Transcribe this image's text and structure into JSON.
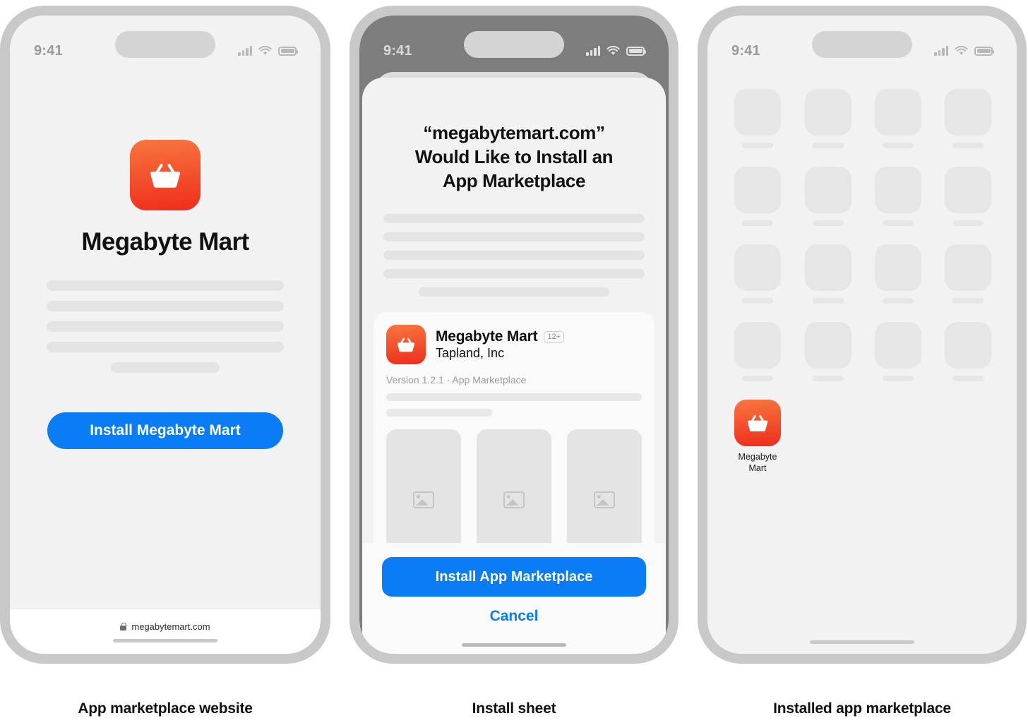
{
  "status_bar": {
    "time": "9:41",
    "icons": [
      "cellular-signal-icon",
      "wifi-icon",
      "battery-icon"
    ]
  },
  "brand": {
    "accent_blue": "#0a7cf5",
    "icon_gradient_top": "#f7763f",
    "icon_gradient_bottom": "#ef2d1e",
    "frame_gray": "#c8c8c8",
    "screen_bg": "#f2f2f2"
  },
  "phone1": {
    "caption": "App marketplace website",
    "app_title": "Megabyte Mart",
    "install_button": "Install Megabyte Mart",
    "url": "megabytemart.com",
    "lock_icon": "lock-icon",
    "app_icon": "shopping-basket-icon"
  },
  "phone2": {
    "caption": "Install sheet",
    "heading": "“megabytemart.com” Would Like to Install an App Marketplace",
    "heading_lines": [
      "“megabytemart.com”",
      "Would Like to Install an",
      "App Marketplace"
    ],
    "app": {
      "name": "Megabyte Mart",
      "age_rating": "12+",
      "developer": "Tapland, Inc",
      "meta": "Version 1.2.1 · App Marketplace",
      "icon": "shopping-basket-icon"
    },
    "screenshots": [
      "image-placeholder-icon",
      "image-placeholder-icon",
      "image-placeholder-icon"
    ],
    "install_button": "Install App Marketplace",
    "cancel_button": "Cancel"
  },
  "phone3": {
    "caption": "Installed app marketplace",
    "installed_app": {
      "label_line1": "Megabyte",
      "label_line2": "Mart",
      "icon": "shopping-basket-icon"
    },
    "placeholder_icon_count": 16
  }
}
